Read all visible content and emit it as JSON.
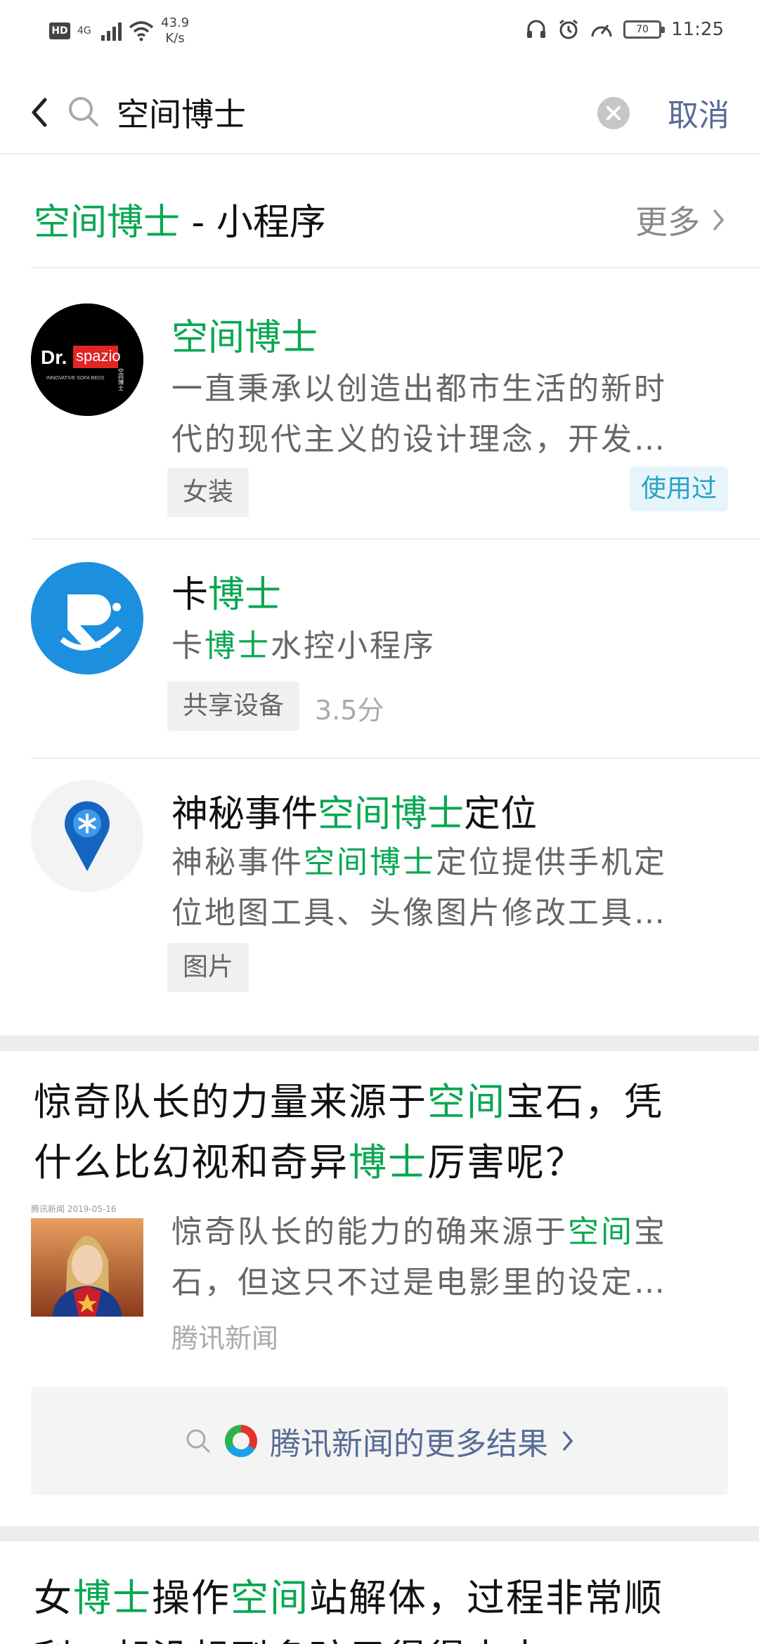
{
  "status_bar": {
    "hd": "HD",
    "network": "4G",
    "speed_value": "43.9",
    "speed_unit": "K/s",
    "battery": "70",
    "time": "11:25"
  },
  "search": {
    "query": "空间博士",
    "cancel_label": "取消"
  },
  "mini_programs": {
    "section_title_hl": "空间博士",
    "section_title_rest": " - 小程序",
    "more_label": "更多",
    "items": [
      {
        "title_parts": [
          "",
          "空间博士",
          ""
        ],
        "desc_line1": "一直秉承以创造出都市生活的新时",
        "desc_line2": "代的现代主义的设计理念，开发…",
        "tag": "女装",
        "used_badge": "使用过",
        "logo_text_a": "Dr.",
        "logo_text_b": "spazio",
        "logo_text_c": "INNOVATIVE SOFA BEDS",
        "logo_text_d": "空间博士"
      },
      {
        "title_parts": [
          "卡",
          "博士",
          ""
        ],
        "desc_parts": [
          "卡",
          "博士",
          "水控小程序"
        ],
        "tag": "共享设备",
        "score": "3.5分"
      },
      {
        "title_parts": [
          "神秘事件",
          "空间博士",
          "定位"
        ],
        "desc_line1_parts": [
          "神秘事件",
          "空间博士",
          "定位提供手机定"
        ],
        "desc_line2": "位地图工具、头像图片修改工具…",
        "tag": "图片"
      }
    ]
  },
  "articles": [
    {
      "title_line1_parts": [
        "惊奇队长的力量来源于",
        "空间",
        "宝石，凭"
      ],
      "title_line2_parts": [
        "什么比幻视和奇异",
        "博士",
        "厉害呢？"
      ],
      "thumb_date": "腾讯新闻 2019-05-16",
      "desc_line1_parts": [
        "惊奇队长的能力的确来源于",
        "空间",
        "宝"
      ],
      "desc_line2": "石，但这只不过是电影里的设定…",
      "source": "腾讯新闻",
      "more_results": "腾讯新闻的更多结果"
    },
    {
      "title_line1_parts": [
        "女",
        "博士",
        "操作",
        "空间",
        "站解体，过程非常顺"
      ],
      "title_line2": "利，却没想到多孩子得得来去"
    }
  ],
  "colors": {
    "highlight": "#07a750",
    "link": "#576b95",
    "used_badge": "#2aa1c6"
  }
}
